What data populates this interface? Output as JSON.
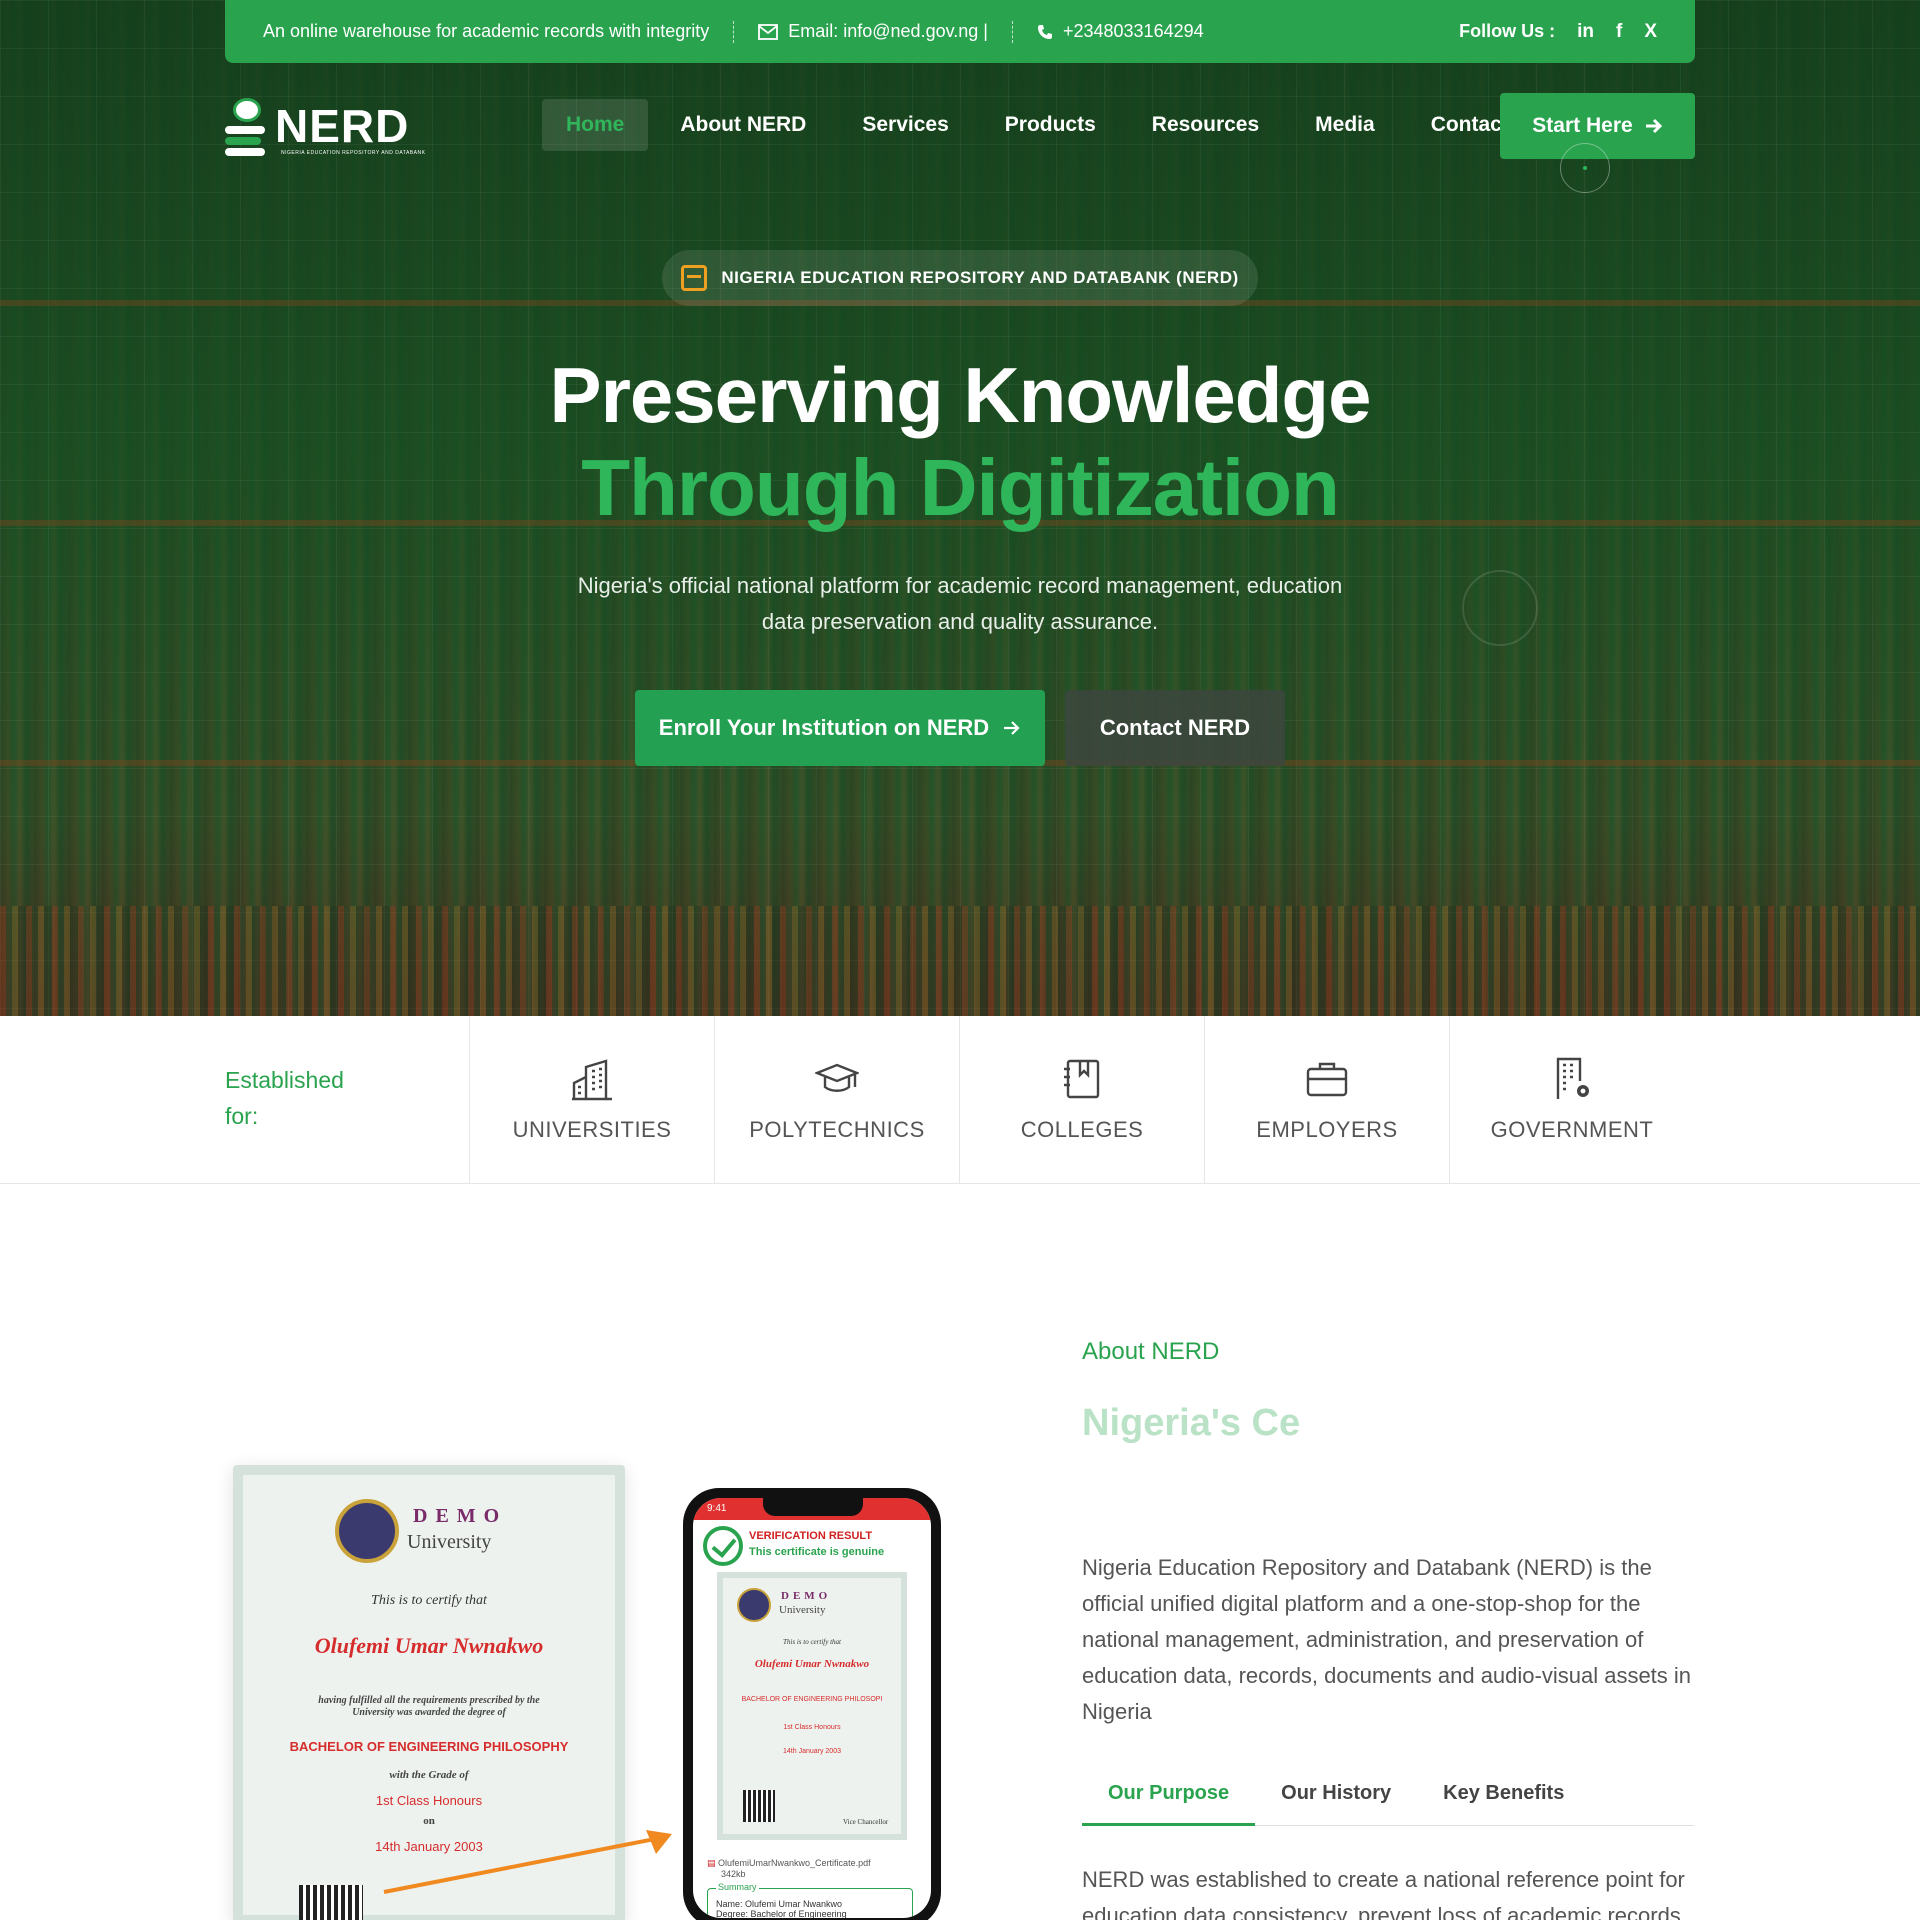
{
  "topbar": {
    "tagline": "An online warehouse for academic records with integrity",
    "email": "Email: info@ned.gov.ng |",
    "phone": "+2348033164294",
    "follow_label": "Follow Us :",
    "social": [
      "in",
      "f",
      "X"
    ]
  },
  "logo": {
    "text": "NERD",
    "subtitle": "NIGERIA EDUCATION REPOSITORY AND DATABANK"
  },
  "nav": {
    "items": [
      "Home",
      "About NERD",
      "Services",
      "Products",
      "Resources",
      "Media",
      "Contact"
    ],
    "active": "Home",
    "cta": "Start Here"
  },
  "hero": {
    "badge": "NIGERIA EDUCATION REPOSITORY AND DATABANK (NERD)",
    "title_line1": "Preserving Knowledge",
    "title_line2": "Through Digitization",
    "description": "Nigeria's official national platform for academic record management, education data preservation and quality  assurance.",
    "primary_button": "Enroll Your Institution on NERD",
    "secondary_button": "Contact NERD"
  },
  "established": {
    "label": "Established for:",
    "categories": [
      "UNIVERSITIES",
      "POLYTECHNICS",
      "COLLEGES",
      "EMPLOYERS",
      "GOVERNMENT"
    ]
  },
  "about": {
    "eyebrow": "About NERD",
    "heading_partial": "Nigeria's Ce",
    "body": "Nigeria Education Repository and Databank (NERD) is the official unified digital platform and a one-stop-shop for the national management, administration, and preservation of education data, records, documents and audio-visual assets in Nigeria",
    "tabs": [
      "Our Purpose",
      "Our History",
      "Key Benefits"
    ],
    "active_tab": "Our Purpose",
    "tab_body": "NERD was established to create a national reference point for education data consistency, prevent loss of academic records"
  },
  "certificate": {
    "demo": "DEMO",
    "university": "University",
    "certify": "This is to certify that",
    "name": "Olufemi Umar Nwnakwo",
    "requirements": "having fulfilled all the requirements prescribed by the University was awarded the degree of",
    "degree": "BACHELOR OF ENGINEERING PHILOSOPHY",
    "grade_label": "with the Grade of",
    "grade": "1st Class Honours",
    "on": "on",
    "date": "14th January 2003"
  },
  "phone": {
    "time": "9:41",
    "result_title": "VERIFICATION RESULT",
    "result_sub": "This certificate is genuine",
    "mini_name": "Olufemi Umar Nwnakwo",
    "mini_degree": "BACHELOR OF ENGINEERING PHILOSOPI",
    "mini_grade": "1st Class Honours",
    "mini_date": "14th January 2003",
    "signature_label": "Vice Chancellor",
    "pdf_name": "OlufemiUmarNwankwo_Certificate.pdf",
    "pdf_size": "342kb",
    "summary_label": "Summary",
    "summary_name": "Name:  Olufemi Umar Nwankwo",
    "summary_degree": "Degree: Bachelor of Engineering"
  },
  "colors": {
    "brand_green": "#2aa34f",
    "accent_orange": "#f0a020"
  }
}
